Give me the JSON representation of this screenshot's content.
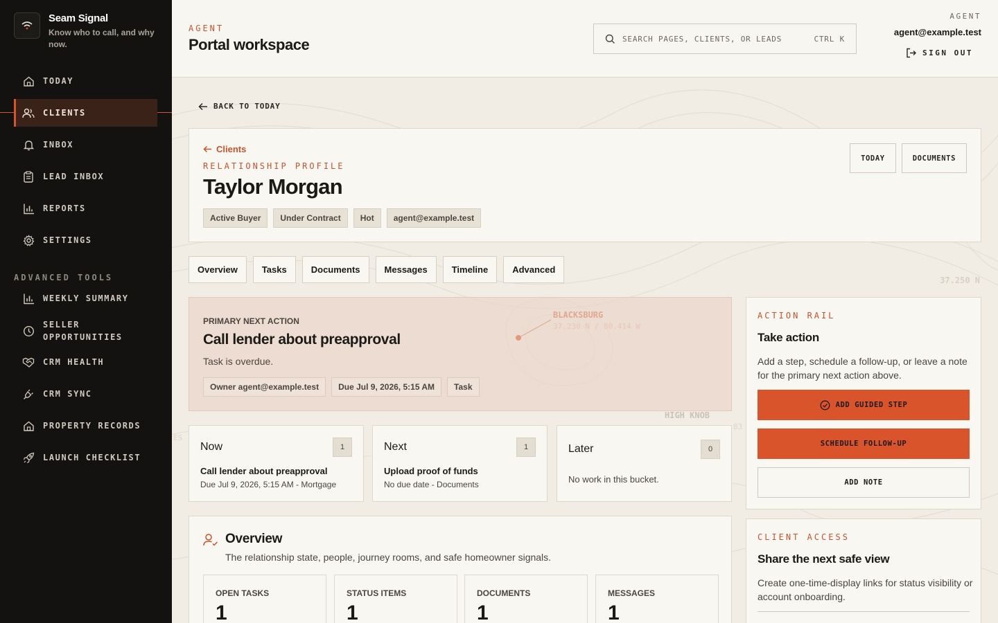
{
  "brand": {
    "name": "Seam Signal",
    "tagline": "Know who to call, and why now."
  },
  "nav": {
    "items": [
      {
        "label": "TODAY",
        "icon": "home-icon"
      },
      {
        "label": "CLIENTS",
        "icon": "users-icon",
        "active": true
      },
      {
        "label": "INBOX",
        "icon": "bell-icon"
      },
      {
        "label": "LEAD INBOX",
        "icon": "clipboard-icon"
      },
      {
        "label": "REPORTS",
        "icon": "bar-chart-icon"
      },
      {
        "label": "SETTINGS",
        "icon": "gear-icon"
      }
    ],
    "section_label": "ADVANCED TOOLS",
    "advanced": [
      {
        "label": "WEEKLY SUMMARY",
        "icon": "bar-chart-icon"
      },
      {
        "label_line1": "SELLER",
        "label_line2": "OPPORTUNITIES",
        "icon": "clock-icon"
      },
      {
        "label": "CRM HEALTH",
        "icon": "handshake-icon"
      },
      {
        "label": "CRM SYNC",
        "icon": "plug-icon"
      },
      {
        "label": "PROPERTY RECORDS",
        "icon": "home-icon"
      },
      {
        "label": "LAUNCH CHECKLIST",
        "icon": "rocket-icon"
      }
    ]
  },
  "header": {
    "eyebrow": "AGENT",
    "title": "Portal workspace",
    "search_placeholder": "SEARCH PAGES, CLIENTS, OR LEADS",
    "search_shortcut": "CTRL K",
    "role": "AGENT",
    "email": "agent@example.test",
    "sign_out": "SIGN OUT"
  },
  "back_link": "BACK TO TODAY",
  "profile": {
    "crumb": "Clients",
    "eyebrow": "RELATIONSHIP PROFILE",
    "name": "Taylor Morgan",
    "tags": [
      "Active Buyer",
      "Under Contract",
      "Hot",
      "agent@example.test"
    ],
    "buttons": [
      "TODAY",
      "DOCUMENTS"
    ]
  },
  "tabs": [
    "Overview",
    "Tasks",
    "Documents",
    "Messages",
    "Timeline",
    "Advanced"
  ],
  "primary_action": {
    "eyebrow": "PRIMARY NEXT ACTION",
    "title": "Call lender about preapproval",
    "status": "Task is overdue.",
    "tags": [
      "Owner agent@example.test",
      "Due Jul 9, 2026, 5:15 AM",
      "Task"
    ]
  },
  "map_labels": {
    "place1": "BLACKSBURG",
    "coords1": "37.230 N / 80.414 W",
    "place2": "HIGH KNOB",
    "coords_edge": "37.250 N",
    "partial1": "83",
    "partial2": "ES"
  },
  "buckets": [
    {
      "head": "Now",
      "count": "1",
      "title": "Call lender about preapproval",
      "meta": "Due Jul 9, 2026, 5:15 AM - Mortgage"
    },
    {
      "head": "Next",
      "count": "1",
      "title": "Upload proof of funds",
      "meta": "No due date - Documents"
    },
    {
      "head": "Later",
      "count": "0",
      "empty": "No work in this bucket."
    }
  ],
  "overview": {
    "title": "Overview",
    "subtitle": "The relationship state, people, journey rooms, and safe homeowner signals.",
    "stats": [
      {
        "label": "OPEN TASKS",
        "value": "1"
      },
      {
        "label": "STATUS ITEMS",
        "value": "1"
      },
      {
        "label": "DOCUMENTS",
        "value": "1"
      },
      {
        "label": "MESSAGES",
        "value": "1"
      }
    ]
  },
  "action_rail": {
    "eyebrow": "ACTION RAIL",
    "title": "Take action",
    "text": "Add a step, schedule a follow-up, or leave a note for the primary next action above.",
    "btn_guided": "ADD GUIDED STEP",
    "btn_schedule": "SCHEDULE FOLLOW-UP",
    "btn_note": "ADD NOTE"
  },
  "client_access": {
    "eyebrow": "CLIENT ACCESS",
    "title": "Share the next safe view",
    "text": "Create one-time-display links for status visibility or account onboarding."
  },
  "colors": {
    "accent": "#d9532b",
    "sidebar": "#141210",
    "page": "#f1ede5",
    "card": "#f9f7f2"
  }
}
